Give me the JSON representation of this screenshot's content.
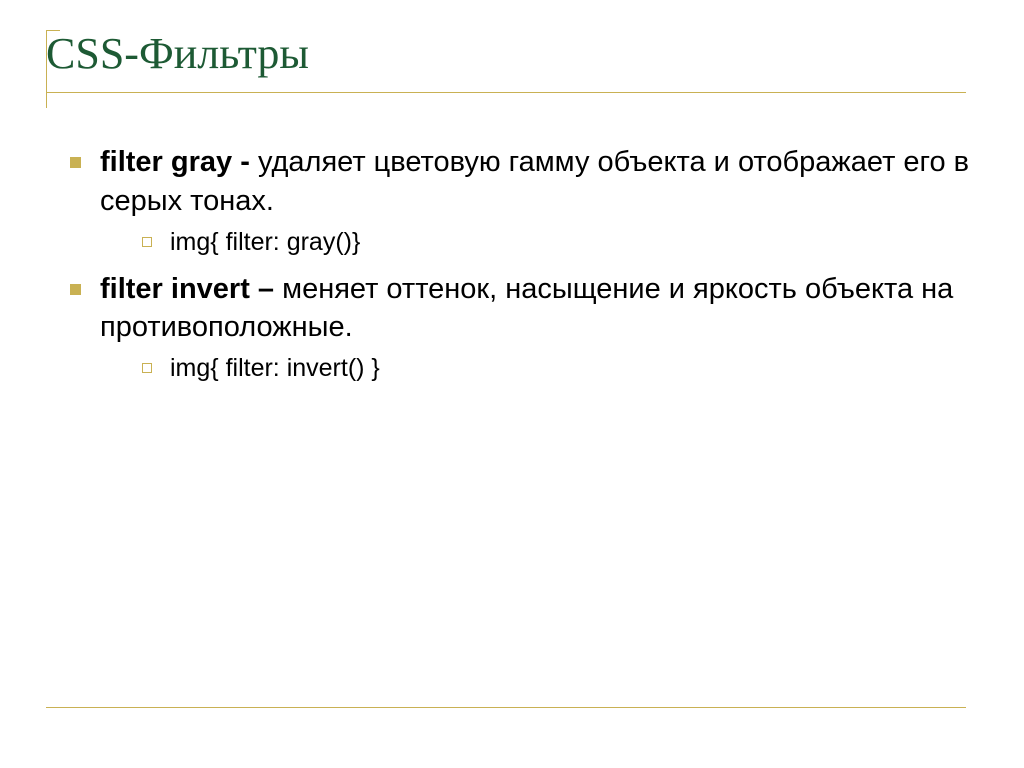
{
  "title": "CSS-Фильтры",
  "items": [
    {
      "bold": "filter gray - ",
      "rest": "удаляет цветовую гамму объекта и отображает его в серых тонах.",
      "code": "img{ filter: gray()}"
    },
    {
      "bold": "filter invert – ",
      "rest": "меняет оттенок, насыщение и яркость объекта на противоположные.",
      "code": "img{ filter: invert() }"
    }
  ]
}
